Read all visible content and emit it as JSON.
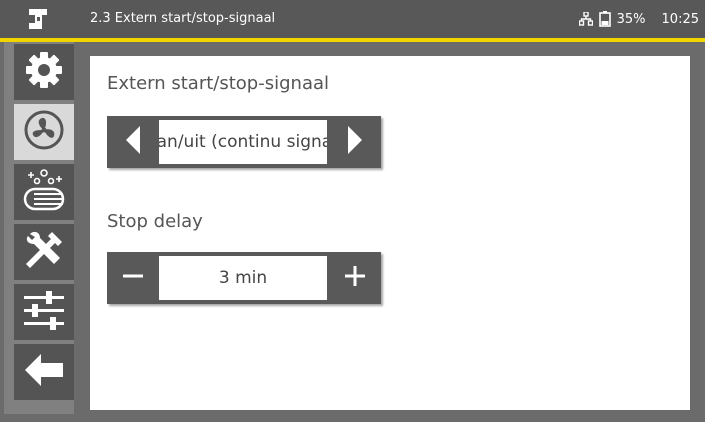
{
  "header": {
    "title": "2.3 Extern start/stop-signaal",
    "battery": "35%",
    "time": "10:25",
    "icons": [
      "logo-icon",
      "network-icon",
      "battery-icon"
    ]
  },
  "colors": {
    "accent": "#f2d400",
    "header_bg": "#585858",
    "button_bg": "#595959"
  },
  "sidebar": {
    "items": [
      {
        "name": "settings",
        "icon": "gear-icon",
        "active": false
      },
      {
        "name": "fan",
        "icon": "fan-icon",
        "active": true
      },
      {
        "name": "filter",
        "icon": "filter-cleaning-icon",
        "active": false
      },
      {
        "name": "service",
        "icon": "tools-icon",
        "active": false
      },
      {
        "name": "adjust",
        "icon": "sliders-icon",
        "active": false
      },
      {
        "name": "back",
        "icon": "back-arrow-icon",
        "active": false
      }
    ]
  },
  "main": {
    "signal_label": "Extern start/stop-signaal",
    "signal_value": "Aan/uit (continu signaal)",
    "delay_label": "Stop delay",
    "delay_value": "3 min"
  }
}
